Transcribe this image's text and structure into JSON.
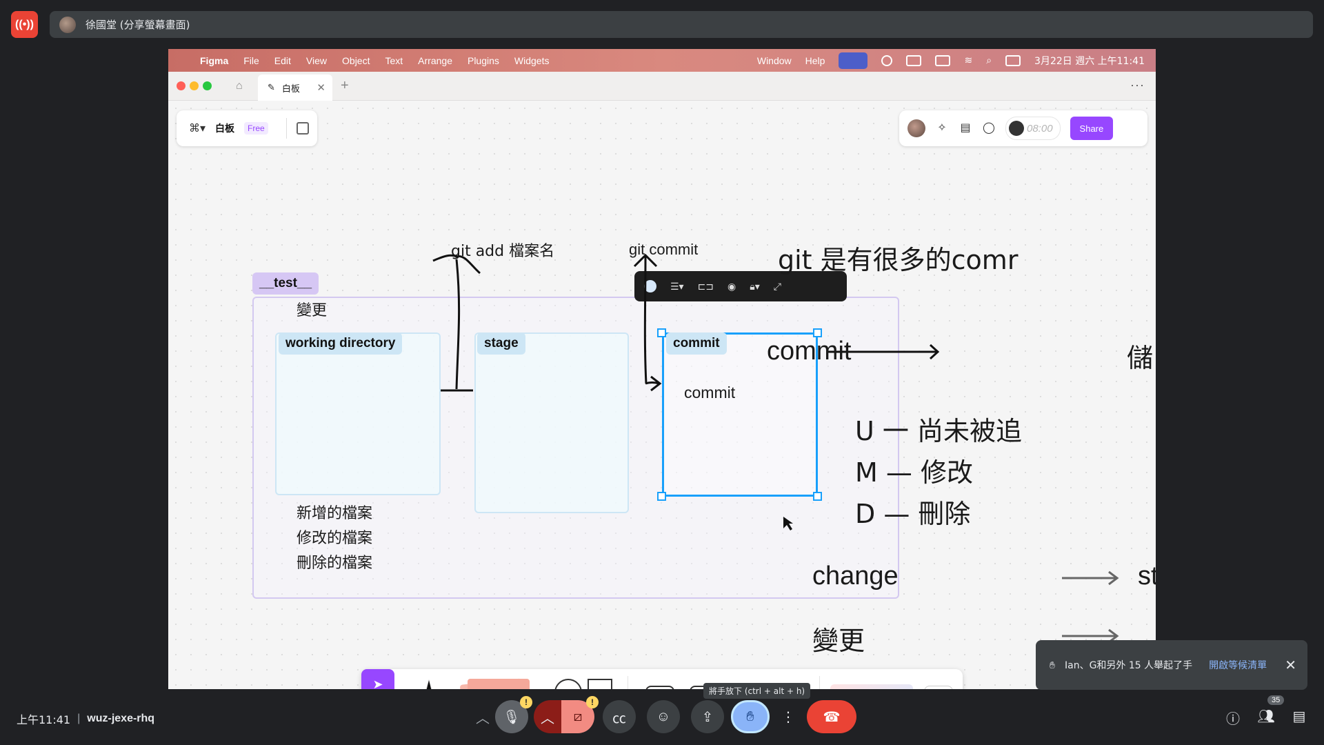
{
  "meet": {
    "presenter": "徐國堂 (分享螢幕畫面)",
    "time": "上午11:41",
    "separator": "|",
    "meeting_code": "wuz-jexe-rhq",
    "tooltip": "將手放下 (ctrl + alt + h)",
    "hand_notification": "Ian、G和另外 15 人舉起了手",
    "hand_link": "開啟等候清單",
    "people_count": "35",
    "badge": "!"
  },
  "mac": {
    "menus": [
      "Figma",
      "File",
      "Edit",
      "View",
      "Object",
      "Text",
      "Arrange",
      "Plugins",
      "Widgets"
    ],
    "right_menus": [
      "Window",
      "Help"
    ],
    "datetime": "3月22日 週六 上午11:41"
  },
  "browser": {
    "tab_title": "白板"
  },
  "figma": {
    "file_name": "白板",
    "plan_badge": "Free",
    "timer": "08:00",
    "share_label": "Share"
  },
  "board": {
    "section_label": "__test__",
    "change_label": "變更",
    "working_directory": "working directory",
    "stage": "stage",
    "commit_label": "commit",
    "commit_text": "commit",
    "git_add": "git add 檔案名",
    "git_commit": "git commit",
    "file_list": [
      "新增的檔案",
      "修改的檔案",
      "刪除的檔案"
    ],
    "notes": {
      "heading": "git 是有很多的comr",
      "commit_arrow_left": "commit",
      "commit_arrow_right": "儲",
      "u_line": "U 一  尚未被追",
      "m_line": "M — 修改",
      "d_line": "D — 刪除",
      "change_left": "change",
      "change_right": "st",
      "biangeng": "變更"
    }
  },
  "colors": {
    "figma_purple": "#9747ff",
    "selection_blue": "#18a0fb",
    "meet_red": "#ea4335"
  }
}
